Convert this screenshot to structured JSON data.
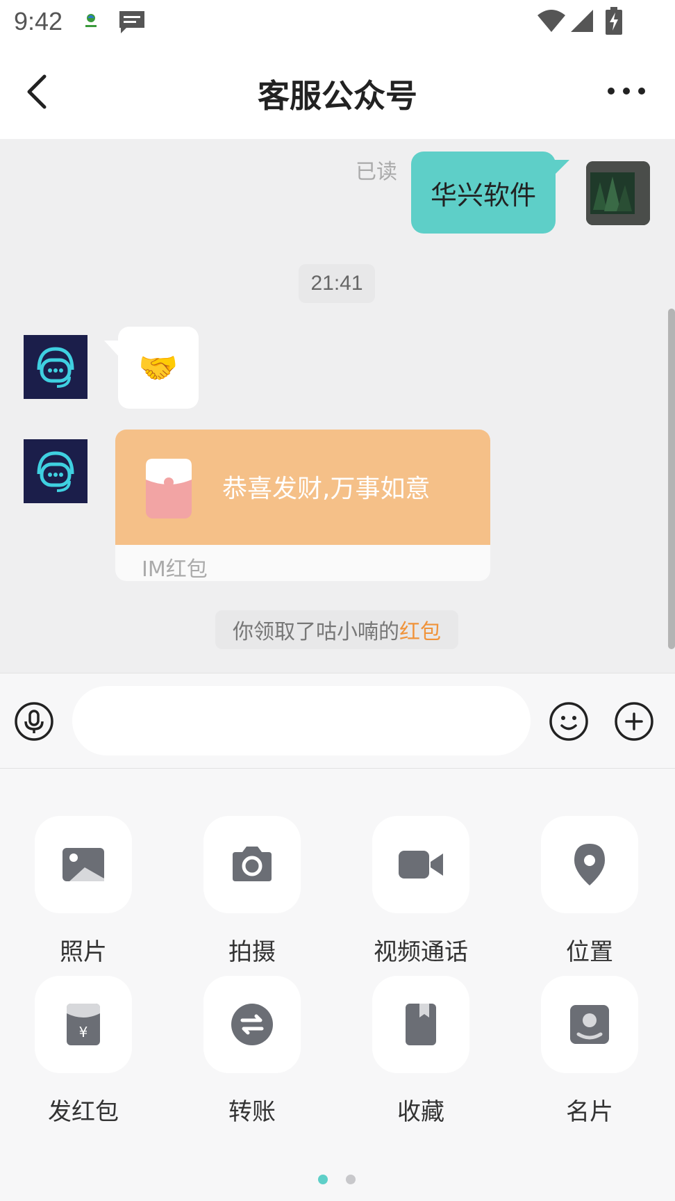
{
  "status_bar": {
    "time": "9:42",
    "icons": [
      "app-logo-icon",
      "message-icon",
      "wifi-icon",
      "signal-icon",
      "battery-charging-icon"
    ]
  },
  "header": {
    "title": "客服公众号",
    "back_icon": "back-arrow-icon",
    "more_icon": "more-dots-icon"
  },
  "chat": {
    "messages": [
      {
        "direction": "outgoing",
        "type": "text",
        "text": "华兴软件",
        "status": "已读",
        "bubble_color": "#5ecfc8"
      },
      {
        "type": "time",
        "text": "21:41"
      },
      {
        "direction": "incoming",
        "type": "emoji",
        "text": "🤝",
        "sender_avatar": "customer-service-bot-icon"
      },
      {
        "direction": "incoming",
        "type": "red_packet",
        "text": "恭喜发财,万事如意",
        "footer": "IM红包",
        "color": "#f5c088"
      },
      {
        "type": "notice",
        "text_prefix": "你领取了咕小喃的",
        "text_highlight": "红包",
        "highlight_color": "#f0933a"
      }
    ]
  },
  "input_bar": {
    "placeholder": "",
    "value": "",
    "icons": [
      "microphone-icon",
      "smiley-icon",
      "plus-icon"
    ]
  },
  "more_panel": {
    "tools": [
      {
        "label": "照片",
        "icon": "photo-icon"
      },
      {
        "label": "拍摄",
        "icon": "camera-icon"
      },
      {
        "label": "视频通话",
        "icon": "video-call-icon"
      },
      {
        "label": "位置",
        "icon": "location-pin-icon"
      },
      {
        "label": "发红包",
        "icon": "red-packet-icon"
      },
      {
        "label": "转账",
        "icon": "transfer-icon"
      },
      {
        "label": "收藏",
        "icon": "bookmark-icon"
      },
      {
        "label": "名片",
        "icon": "contact-card-icon"
      }
    ],
    "pager": {
      "pages": 2,
      "current": 1
    }
  },
  "colors": {
    "accent": "#5ecfc8",
    "chat_background": "#efeff0",
    "red_packet": "#f5c088",
    "icon_gray": "#6b6e75"
  }
}
